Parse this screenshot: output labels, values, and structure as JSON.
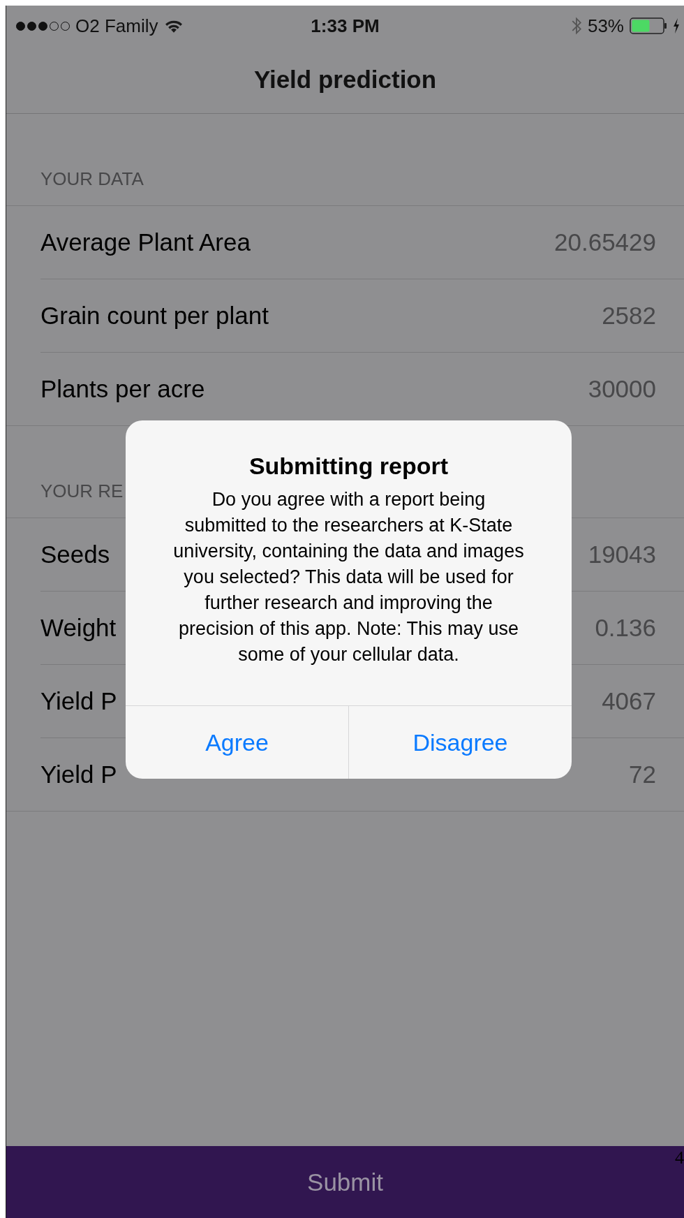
{
  "status_bar": {
    "carrier": "O2 Family",
    "time": "1:33 PM",
    "battery": "53%",
    "signal_dots": [
      {
        "filled": true
      },
      {
        "filled": true
      },
      {
        "filled": true
      },
      {
        "filled": false
      },
      {
        "filled": false
      }
    ]
  },
  "nav_bar": {
    "title": "Yield prediction"
  },
  "sections": [
    {
      "header": "YOUR DATA",
      "rows": [
        {
          "label": "Average Plant Area",
          "value": "20.65429"
        },
        {
          "label": "Grain count per plant",
          "value": "2582"
        },
        {
          "label": "Plants per acre",
          "value": "30000"
        }
      ]
    },
    {
      "header": "YOUR RE",
      "rows": [
        {
          "label": "Seeds",
          "value": "19043"
        },
        {
          "label": "Weight",
          "value": "0.136"
        },
        {
          "label": "Yield P",
          "value": "4067"
        },
        {
          "label": "Yield P",
          "value": "72"
        }
      ]
    }
  ],
  "dialog": {
    "title": "Submitting report",
    "message": "Do you agree with a report being submitted to the researchers at K-State university, containing the data and images you selected? This data will be used for further research and improving the precision of this app. Note: This may use some of your cellular data.",
    "buttons": [
      "Agree",
      "Disagree"
    ]
  },
  "submit_button": {
    "label": "Submit"
  },
  "corner_mark": "4"
}
